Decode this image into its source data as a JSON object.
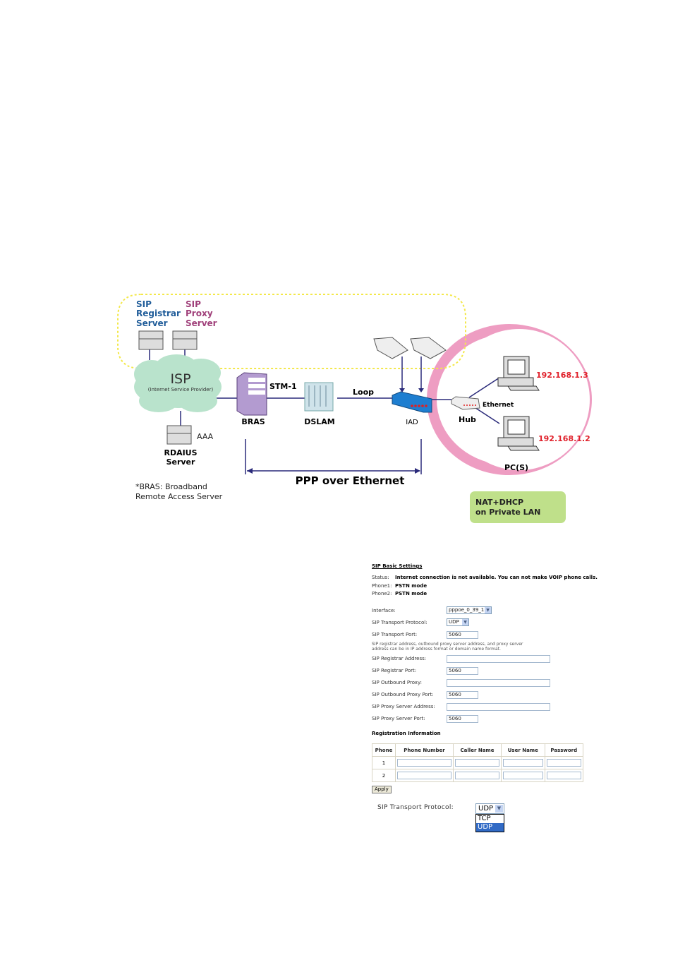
{
  "diagram": {
    "sip_registrar": [
      "SIP",
      "Registrar",
      "Server"
    ],
    "sip_proxy": [
      "SIP",
      "Proxy",
      "Server"
    ],
    "isp": "ISP",
    "isp_sub": "(Internet Service Provider)",
    "aaa": "AAA",
    "radius": [
      "RDAIUS",
      "Server"
    ],
    "bras": "BRAS",
    "stm": "STM-1",
    "dslam": "DSLAM",
    "loop": "Loop",
    "iad": "IAD",
    "hub": "Hub",
    "ethernet": "Ethernet",
    "ip1": "192.168.1.3",
    "ip2": "192.168.1.2",
    "pcs": "PC(S)",
    "ppp": "PPP over Ethernet",
    "footnote": [
      "*BRAS: Broadband",
      "Remote Access Server"
    ],
    "nat": [
      "NAT+DHCP",
      "on Private LAN"
    ],
    "colors": {
      "registrar": "#1f5c99",
      "proxy": "#a0407a",
      "ip": "#e0202a",
      "ring": "#ee9dc2",
      "nat_bg": "#bfe08a",
      "line": "#2a2a7a",
      "dash": "#f3e84a"
    }
  },
  "form": {
    "title": "SIP Basic Settings",
    "status_label": "Status:",
    "status_value": "Internet connection is not available. You can not make VOIP phone calls.",
    "phone1_label": "Phone1:",
    "phone1_value": "PSTN mode",
    "phone2_label": "Phone2:",
    "phone2_value": "PSTN mode",
    "interface_label": "Interface:",
    "interface_value": "pppoe_0_39_1",
    "transport_protocol_label": "SIP Transport Protocol:",
    "transport_protocol_value": "UDP",
    "transport_port_label": "SIP Transport Port:",
    "transport_port_value": "5060",
    "note": [
      "SIP registrar address, outbound proxy server address, and proxy server",
      "address can be in IP address format or domain name format."
    ],
    "registrar_address_label": "SIP Registrar Address:",
    "registrar_address_value": "",
    "registrar_port_label": "SIP Registrar Port:",
    "registrar_port_value": "5060",
    "outbound_proxy_label": "SIP Outbound Proxy:",
    "outbound_proxy_value": "",
    "outbound_proxy_port_label": "SIP Outbound Proxy Port:",
    "outbound_proxy_port_value": "5060",
    "proxy_address_label": "SIP Proxy Server Address:",
    "proxy_address_value": "",
    "proxy_port_label": "SIP Proxy Server Port:",
    "proxy_port_value": "5060",
    "registration_title": "Registration Information",
    "table_headers": [
      "Phone",
      "Phone Number",
      "Caller Name",
      "User Name",
      "Password"
    ],
    "rows": [
      "1",
      "2"
    ],
    "apply": "Apply"
  },
  "dropdown_example": {
    "label": "SIP Transport Protocol:",
    "value": "UDP",
    "options": [
      "TCP",
      "UDP"
    ],
    "selected": "UDP"
  }
}
